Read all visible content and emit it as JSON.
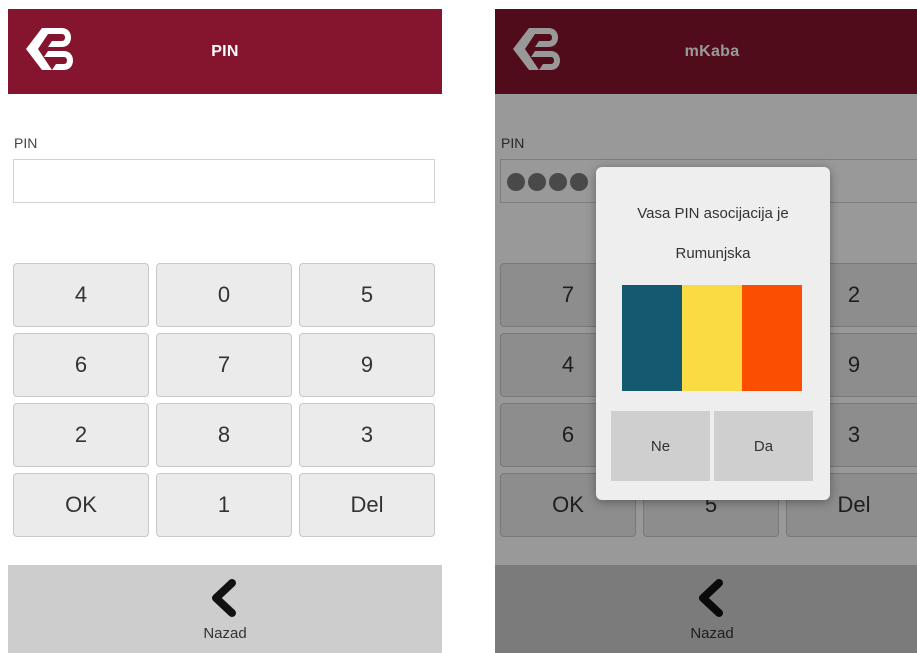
{
  "left": {
    "header": {
      "title": "PIN"
    },
    "pin_label": "PIN",
    "pin_value": "",
    "keys": [
      [
        "4",
        "0",
        "5"
      ],
      [
        "6",
        "7",
        "9"
      ],
      [
        "2",
        "8",
        "3"
      ],
      [
        "OK",
        "1",
        "Del"
      ]
    ],
    "nav": {
      "back_label": "Nazad"
    }
  },
  "right": {
    "header": {
      "title": "mKaba"
    },
    "pin_label": "PIN",
    "pin_dots": 4,
    "keys": [
      [
        "7",
        "",
        "2"
      ],
      [
        "4",
        "",
        "9"
      ],
      [
        "6",
        "",
        "3"
      ],
      [
        "OK",
        "5",
        "Del"
      ]
    ],
    "nav": {
      "back_label": "Nazad"
    },
    "dialog": {
      "message_line1": "Vasa PIN asocijacija je",
      "message_line2": "Rumunjska",
      "flag_colors": [
        "#14596f",
        "#fbdb44",
        "#fc4e01"
      ],
      "no_label": "Ne",
      "yes_label": "Da"
    }
  },
  "colors": {
    "header_bg": "#85152e",
    "key_bg": "#ebebeb",
    "nav_bg": "#cdcdcd"
  }
}
